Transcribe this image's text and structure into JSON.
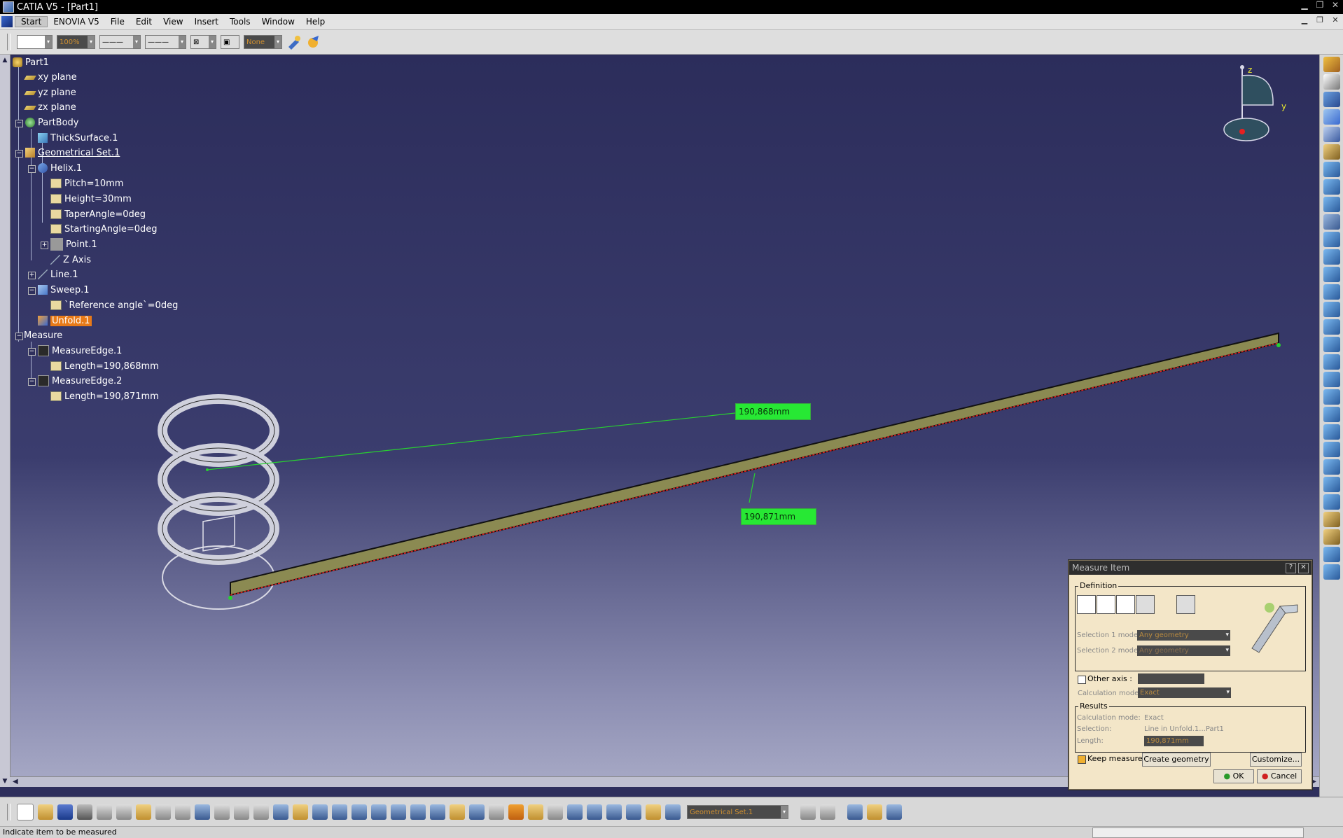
{
  "window": {
    "title": "CATIA V5 - [Part1]"
  },
  "menu": {
    "start": "Start",
    "items": [
      "ENOVIA V5",
      "File",
      "Edit",
      "View",
      "Insert",
      "Tools",
      "Window",
      "Help"
    ]
  },
  "top_toolbar": {
    "zoom_value": "100%",
    "layer_value": "None"
  },
  "tree": {
    "root": "Part1",
    "xy_plane": "xy plane",
    "yz_plane": "yz plane",
    "zx_plane": "zx plane",
    "partbody": "PartBody",
    "thicksurface": "ThickSurface.1",
    "gset": "Geometrical Set.1",
    "helix": "Helix.1",
    "pitch": "Pitch=10mm",
    "height": "Height=30mm",
    "taper": "TaperAngle=0deg",
    "starting": "StartingAngle=0deg",
    "point": "Point.1",
    "zaxis": "Z Axis",
    "line": "Line.1",
    "sweep": "Sweep.1",
    "refangle": "`Reference angle`=0deg",
    "unfold": "Unfold.1",
    "measure": "Measure",
    "medge1": "MeasureEdge.1",
    "length1": "Length=190,868mm",
    "medge2": "MeasureEdge.2",
    "length2": "Length=190,871mm"
  },
  "scene": {
    "measure1": "190,868mm",
    "measure2": "190,871mm",
    "axis_z": "z",
    "axis_y": "y"
  },
  "dialog": {
    "title": "Measure Item",
    "help": "?",
    "close": "✕",
    "definition": "Definition",
    "sel1_label": "Selection 1 mode:",
    "sel1_value": "Any geometry",
    "sel2_label": "Selection 2 mode:",
    "sel2_value": "Any geometry",
    "other_axis": "Other axis :",
    "calc_label": "Calculation mode:",
    "calc_value": "Exact",
    "results": "Results",
    "res_calc_label": "Calculation mode:",
    "res_calc_value": "Exact",
    "res_sel_label": "Selection:",
    "res_sel_value": "Line in Unfold.1...Part1",
    "res_len_label": "Length:",
    "res_len_value": "190,871mm",
    "keep": "Keep measure",
    "create": "Create geometry",
    "customize": "Customize...",
    "ok": "OK",
    "cancel": "Cancel"
  },
  "bottom_toolbar": {
    "current_set": "Geometrical Set.1"
  },
  "status": {
    "message": "Indicate item to be measured"
  },
  "colors": {
    "viewport_top": "#2c2d5b",
    "selected": "#e87a18",
    "measure_label": "#27e834",
    "dialog_bg": "#f3e6c8"
  }
}
